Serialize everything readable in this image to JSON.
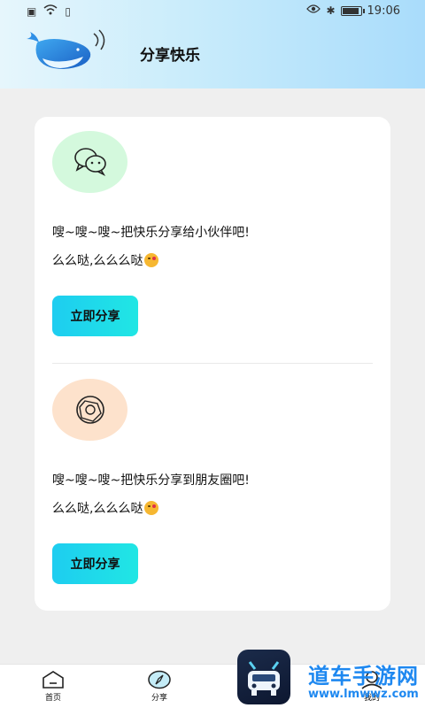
{
  "status_bar": {
    "time": "19:06"
  },
  "header": {
    "title": "分享快乐"
  },
  "shares": [
    {
      "line1": "嗖~嗖~嗖~把快乐分享给小伙伴吧!",
      "line2": "么么哒,么么么哒",
      "button": "立即分享",
      "icon": "wechat-icon"
    },
    {
      "line1": "嗖~嗖~嗖~把快乐分享到朋友圈吧!",
      "line2": "么么哒,么么么哒",
      "button": "立即分享",
      "icon": "moments-icon"
    }
  ],
  "tabs": [
    {
      "label": "首页",
      "icon": "home-icon"
    },
    {
      "label": "分享",
      "icon": "compass-icon"
    },
    {
      "label": "我的",
      "icon": "profile-icon"
    }
  ],
  "watermark": {
    "text": "道车手游网",
    "url": "www.lmwwz.com"
  },
  "colors": {
    "button_start": "#1ecdf0",
    "button_end": "#20e6e4",
    "header_end": "#a9dcfb"
  }
}
